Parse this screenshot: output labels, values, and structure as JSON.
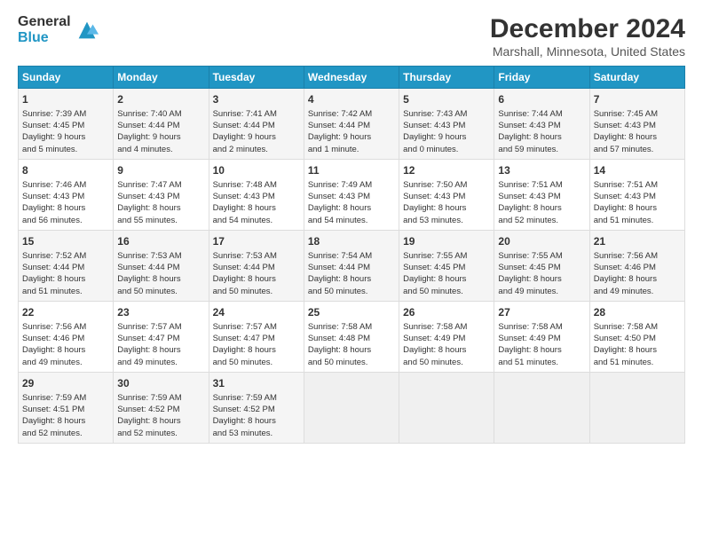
{
  "header": {
    "logo_line1": "General",
    "logo_line2": "Blue",
    "title": "December 2024",
    "subtitle": "Marshall, Minnesota, United States"
  },
  "calendar": {
    "weekdays": [
      "Sunday",
      "Monday",
      "Tuesday",
      "Wednesday",
      "Thursday",
      "Friday",
      "Saturday"
    ],
    "weeks": [
      [
        {
          "day": "1",
          "lines": [
            "Sunrise: 7:39 AM",
            "Sunset: 4:45 PM",
            "Daylight: 9 hours",
            "and 5 minutes."
          ]
        },
        {
          "day": "2",
          "lines": [
            "Sunrise: 7:40 AM",
            "Sunset: 4:44 PM",
            "Daylight: 9 hours",
            "and 4 minutes."
          ]
        },
        {
          "day": "3",
          "lines": [
            "Sunrise: 7:41 AM",
            "Sunset: 4:44 PM",
            "Daylight: 9 hours",
            "and 2 minutes."
          ]
        },
        {
          "day": "4",
          "lines": [
            "Sunrise: 7:42 AM",
            "Sunset: 4:44 PM",
            "Daylight: 9 hours",
            "and 1 minute."
          ]
        },
        {
          "day": "5",
          "lines": [
            "Sunrise: 7:43 AM",
            "Sunset: 4:43 PM",
            "Daylight: 9 hours",
            "and 0 minutes."
          ]
        },
        {
          "day": "6",
          "lines": [
            "Sunrise: 7:44 AM",
            "Sunset: 4:43 PM",
            "Daylight: 8 hours",
            "and 59 minutes."
          ]
        },
        {
          "day": "7",
          "lines": [
            "Sunrise: 7:45 AM",
            "Sunset: 4:43 PM",
            "Daylight: 8 hours",
            "and 57 minutes."
          ]
        }
      ],
      [
        {
          "day": "8",
          "lines": [
            "Sunrise: 7:46 AM",
            "Sunset: 4:43 PM",
            "Daylight: 8 hours",
            "and 56 minutes."
          ]
        },
        {
          "day": "9",
          "lines": [
            "Sunrise: 7:47 AM",
            "Sunset: 4:43 PM",
            "Daylight: 8 hours",
            "and 55 minutes."
          ]
        },
        {
          "day": "10",
          "lines": [
            "Sunrise: 7:48 AM",
            "Sunset: 4:43 PM",
            "Daylight: 8 hours",
            "and 54 minutes."
          ]
        },
        {
          "day": "11",
          "lines": [
            "Sunrise: 7:49 AM",
            "Sunset: 4:43 PM",
            "Daylight: 8 hours",
            "and 54 minutes."
          ]
        },
        {
          "day": "12",
          "lines": [
            "Sunrise: 7:50 AM",
            "Sunset: 4:43 PM",
            "Daylight: 8 hours",
            "and 53 minutes."
          ]
        },
        {
          "day": "13",
          "lines": [
            "Sunrise: 7:51 AM",
            "Sunset: 4:43 PM",
            "Daylight: 8 hours",
            "and 52 minutes."
          ]
        },
        {
          "day": "14",
          "lines": [
            "Sunrise: 7:51 AM",
            "Sunset: 4:43 PM",
            "Daylight: 8 hours",
            "and 51 minutes."
          ]
        }
      ],
      [
        {
          "day": "15",
          "lines": [
            "Sunrise: 7:52 AM",
            "Sunset: 4:44 PM",
            "Daylight: 8 hours",
            "and 51 minutes."
          ]
        },
        {
          "day": "16",
          "lines": [
            "Sunrise: 7:53 AM",
            "Sunset: 4:44 PM",
            "Daylight: 8 hours",
            "and 50 minutes."
          ]
        },
        {
          "day": "17",
          "lines": [
            "Sunrise: 7:53 AM",
            "Sunset: 4:44 PM",
            "Daylight: 8 hours",
            "and 50 minutes."
          ]
        },
        {
          "day": "18",
          "lines": [
            "Sunrise: 7:54 AM",
            "Sunset: 4:44 PM",
            "Daylight: 8 hours",
            "and 50 minutes."
          ]
        },
        {
          "day": "19",
          "lines": [
            "Sunrise: 7:55 AM",
            "Sunset: 4:45 PM",
            "Daylight: 8 hours",
            "and 50 minutes."
          ]
        },
        {
          "day": "20",
          "lines": [
            "Sunrise: 7:55 AM",
            "Sunset: 4:45 PM",
            "Daylight: 8 hours",
            "and 49 minutes."
          ]
        },
        {
          "day": "21",
          "lines": [
            "Sunrise: 7:56 AM",
            "Sunset: 4:46 PM",
            "Daylight: 8 hours",
            "and 49 minutes."
          ]
        }
      ],
      [
        {
          "day": "22",
          "lines": [
            "Sunrise: 7:56 AM",
            "Sunset: 4:46 PM",
            "Daylight: 8 hours",
            "and 49 minutes."
          ]
        },
        {
          "day": "23",
          "lines": [
            "Sunrise: 7:57 AM",
            "Sunset: 4:47 PM",
            "Daylight: 8 hours",
            "and 49 minutes."
          ]
        },
        {
          "day": "24",
          "lines": [
            "Sunrise: 7:57 AM",
            "Sunset: 4:47 PM",
            "Daylight: 8 hours",
            "and 50 minutes."
          ]
        },
        {
          "day": "25",
          "lines": [
            "Sunrise: 7:58 AM",
            "Sunset: 4:48 PM",
            "Daylight: 8 hours",
            "and 50 minutes."
          ]
        },
        {
          "day": "26",
          "lines": [
            "Sunrise: 7:58 AM",
            "Sunset: 4:49 PM",
            "Daylight: 8 hours",
            "and 50 minutes."
          ]
        },
        {
          "day": "27",
          "lines": [
            "Sunrise: 7:58 AM",
            "Sunset: 4:49 PM",
            "Daylight: 8 hours",
            "and 51 minutes."
          ]
        },
        {
          "day": "28",
          "lines": [
            "Sunrise: 7:58 AM",
            "Sunset: 4:50 PM",
            "Daylight: 8 hours",
            "and 51 minutes."
          ]
        }
      ],
      [
        {
          "day": "29",
          "lines": [
            "Sunrise: 7:59 AM",
            "Sunset: 4:51 PM",
            "Daylight: 8 hours",
            "and 52 minutes."
          ]
        },
        {
          "day": "30",
          "lines": [
            "Sunrise: 7:59 AM",
            "Sunset: 4:52 PM",
            "Daylight: 8 hours",
            "and 52 minutes."
          ]
        },
        {
          "day": "31",
          "lines": [
            "Sunrise: 7:59 AM",
            "Sunset: 4:52 PM",
            "Daylight: 8 hours",
            "and 53 minutes."
          ]
        },
        null,
        null,
        null,
        null
      ]
    ]
  }
}
